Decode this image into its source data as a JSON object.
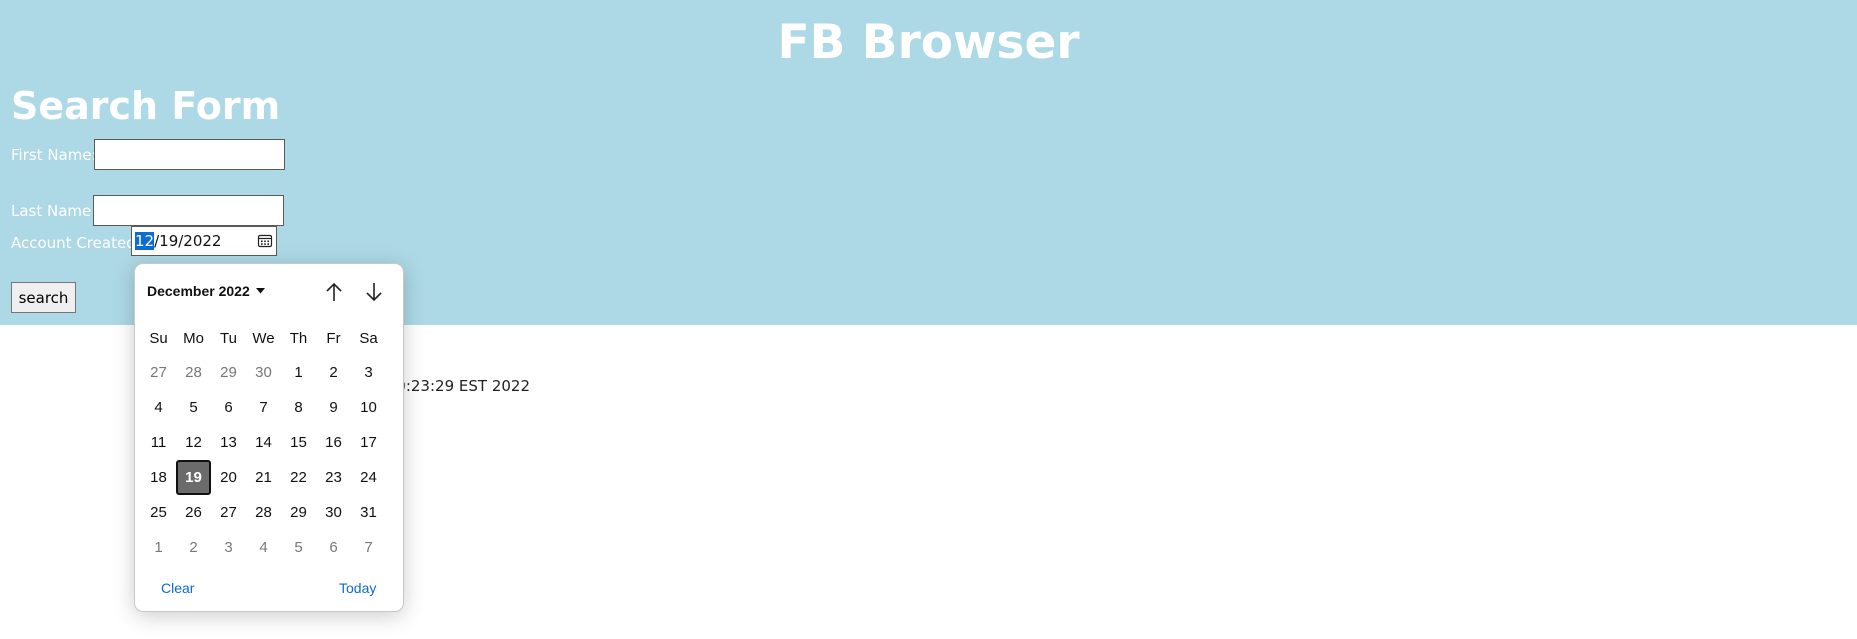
{
  "app": {
    "title": "FB Browser"
  },
  "form": {
    "title": "Search Form",
    "first_name": {
      "label": "First Name:",
      "value": ""
    },
    "last_name": {
      "label": "Last Name:",
      "value": ""
    },
    "account_created": {
      "label": "Account Created",
      "month": "12",
      "rest": "/19/2022"
    },
    "search_label": "search"
  },
  "status": {
    "timestamp": "10:23:29 EST 2022"
  },
  "datepicker": {
    "month_label": "December 2022",
    "weekdays": [
      "Su",
      "Mo",
      "Tu",
      "We",
      "Th",
      "Fr",
      "Sa"
    ],
    "weeks": [
      [
        {
          "d": "27",
          "m": true
        },
        {
          "d": "28",
          "m": true
        },
        {
          "d": "29",
          "m": true
        },
        {
          "d": "30",
          "m": true
        },
        {
          "d": "1"
        },
        {
          "d": "2"
        },
        {
          "d": "3"
        }
      ],
      [
        {
          "d": "4"
        },
        {
          "d": "5"
        },
        {
          "d": "6"
        },
        {
          "d": "7"
        },
        {
          "d": "8"
        },
        {
          "d": "9"
        },
        {
          "d": "10"
        }
      ],
      [
        {
          "d": "11"
        },
        {
          "d": "12"
        },
        {
          "d": "13"
        },
        {
          "d": "14"
        },
        {
          "d": "15"
        },
        {
          "d": "16"
        },
        {
          "d": "17"
        }
      ],
      [
        {
          "d": "18"
        },
        {
          "d": "19",
          "sel": true
        },
        {
          "d": "20"
        },
        {
          "d": "21"
        },
        {
          "d": "22"
        },
        {
          "d": "23"
        },
        {
          "d": "24"
        }
      ],
      [
        {
          "d": "25"
        },
        {
          "d": "26"
        },
        {
          "d": "27"
        },
        {
          "d": "28"
        },
        {
          "d": "29"
        },
        {
          "d": "30"
        },
        {
          "d": "31"
        }
      ],
      [
        {
          "d": "1",
          "m": true
        },
        {
          "d": "2",
          "m": true
        },
        {
          "d": "3",
          "m": true
        },
        {
          "d": "4",
          "m": true
        },
        {
          "d": "5",
          "m": true
        },
        {
          "d": "6",
          "m": true
        },
        {
          "d": "7",
          "m": true
        }
      ]
    ],
    "clear_label": "Clear",
    "today_label": "Today",
    "icons": {
      "month_menu": "caret-down-icon",
      "prev": "arrow-up-icon",
      "next": "arrow-down-icon",
      "calendar": "calendar-icon"
    }
  },
  "colors": {
    "header_bg": "#add8e6",
    "accent": "#0a6cd6",
    "selected_day": "#6b6b6b"
  }
}
